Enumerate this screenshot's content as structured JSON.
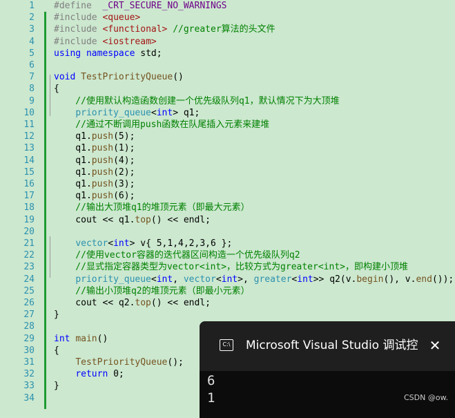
{
  "code_lines": [
    {
      "n": "1",
      "tokens": [
        {
          "t": "#define  ",
          "c": "p"
        },
        {
          "t": "_CRT_SECURE_NO_WARNINGS",
          "c": "m"
        }
      ]
    },
    {
      "n": "2",
      "tokens": [
        {
          "t": "#include ",
          "c": "p"
        },
        {
          "t": "<queue>",
          "c": "s"
        }
      ]
    },
    {
      "n": "3",
      "tokens": [
        {
          "t": "#include ",
          "c": "p"
        },
        {
          "t": "<functional>",
          "c": "s"
        },
        {
          "t": " //greater算法的头文件",
          "c": "c"
        }
      ]
    },
    {
      "n": "4",
      "tokens": [
        {
          "t": "#include ",
          "c": "p"
        },
        {
          "t": "<iostream>",
          "c": "s"
        }
      ]
    },
    {
      "n": "5",
      "tokens": [
        {
          "t": "using",
          "c": "k"
        },
        {
          "t": " ",
          "c": "n"
        },
        {
          "t": "namespace",
          "c": "k"
        },
        {
          "t": " std;",
          "c": "n"
        }
      ]
    },
    {
      "n": "6",
      "tokens": []
    },
    {
      "n": "7",
      "tokens": [
        {
          "t": "void",
          "c": "k"
        },
        {
          "t": " ",
          "c": "n"
        },
        {
          "t": "TestPriorityQueue",
          "c": "f"
        },
        {
          "t": "()",
          "c": "n"
        }
      ]
    },
    {
      "n": "8",
      "tokens": [
        {
          "t": "{",
          "c": "n"
        }
      ]
    },
    {
      "n": "9",
      "tokens": [
        {
          "t": "    //使用默认构造函数创建一个优先级队列q1，默认情况下为大顶堆",
          "c": "c"
        }
      ]
    },
    {
      "n": "10",
      "tokens": [
        {
          "t": "    ",
          "c": "n"
        },
        {
          "t": "priority_queue",
          "c": "t"
        },
        {
          "t": "<",
          "c": "n"
        },
        {
          "t": "int",
          "c": "k"
        },
        {
          "t": "> q1;",
          "c": "n"
        }
      ]
    },
    {
      "n": "11",
      "tokens": [
        {
          "t": "    //通过不断调用push函数在队尾插入元素来建堆",
          "c": "c"
        }
      ]
    },
    {
      "n": "12",
      "tokens": [
        {
          "t": "    q1.",
          "c": "n"
        },
        {
          "t": "push",
          "c": "f"
        },
        {
          "t": "(5);",
          "c": "n"
        }
      ]
    },
    {
      "n": "13",
      "tokens": [
        {
          "t": "    q1.",
          "c": "n"
        },
        {
          "t": "push",
          "c": "f"
        },
        {
          "t": "(1);",
          "c": "n"
        }
      ]
    },
    {
      "n": "14",
      "tokens": [
        {
          "t": "    q1.",
          "c": "n"
        },
        {
          "t": "push",
          "c": "f"
        },
        {
          "t": "(4);",
          "c": "n"
        }
      ]
    },
    {
      "n": "15",
      "tokens": [
        {
          "t": "    q1.",
          "c": "n"
        },
        {
          "t": "push",
          "c": "f"
        },
        {
          "t": "(2);",
          "c": "n"
        }
      ]
    },
    {
      "n": "16",
      "tokens": [
        {
          "t": "    q1.",
          "c": "n"
        },
        {
          "t": "push",
          "c": "f"
        },
        {
          "t": "(3);",
          "c": "n"
        }
      ]
    },
    {
      "n": "17",
      "tokens": [
        {
          "t": "    q1.",
          "c": "n"
        },
        {
          "t": "push",
          "c": "f"
        },
        {
          "t": "(6);",
          "c": "n"
        }
      ]
    },
    {
      "n": "18",
      "tokens": [
        {
          "t": "    //输出大顶堆q1的堆顶元素（即最大元素）",
          "c": "c"
        }
      ]
    },
    {
      "n": "19",
      "tokens": [
        {
          "t": "    cout << q1.",
          "c": "n"
        },
        {
          "t": "top",
          "c": "f"
        },
        {
          "t": "() << endl;",
          "c": "n"
        }
      ]
    },
    {
      "n": "20",
      "tokens": []
    },
    {
      "n": "21",
      "tokens": [
        {
          "t": "    ",
          "c": "n"
        },
        {
          "t": "vector",
          "c": "t"
        },
        {
          "t": "<",
          "c": "n"
        },
        {
          "t": "int",
          "c": "k"
        },
        {
          "t": "> v{ 5,1,4,2,3,6 };",
          "c": "n"
        }
      ]
    },
    {
      "n": "22",
      "tokens": [
        {
          "t": "    //使用vector容器的迭代器区间构造一个优先级队列q2",
          "c": "c"
        }
      ]
    },
    {
      "n": "23",
      "tokens": [
        {
          "t": "    //显式指定容器类型为vector<int>，比较方式为greater<int>，即构建小顶堆",
          "c": "c"
        }
      ]
    },
    {
      "n": "24",
      "tokens": [
        {
          "t": "    ",
          "c": "n"
        },
        {
          "t": "priority_queue",
          "c": "t"
        },
        {
          "t": "<",
          "c": "n"
        },
        {
          "t": "int",
          "c": "k"
        },
        {
          "t": ", ",
          "c": "n"
        },
        {
          "t": "vector",
          "c": "t"
        },
        {
          "t": "<",
          "c": "n"
        },
        {
          "t": "int",
          "c": "k"
        },
        {
          "t": ">, ",
          "c": "n"
        },
        {
          "t": "greater",
          "c": "t"
        },
        {
          "t": "<",
          "c": "n"
        },
        {
          "t": "int",
          "c": "k"
        },
        {
          "t": ">> q2(v.",
          "c": "n"
        },
        {
          "t": "begin",
          "c": "f"
        },
        {
          "t": "(), v.",
          "c": "n"
        },
        {
          "t": "end",
          "c": "f"
        },
        {
          "t": "());",
          "c": "n"
        }
      ]
    },
    {
      "n": "25",
      "tokens": [
        {
          "t": "    //输出小顶堆q2的堆顶元素（即最小元素）",
          "c": "c"
        }
      ]
    },
    {
      "n": "26",
      "tokens": [
        {
          "t": "    cout << q2.",
          "c": "n"
        },
        {
          "t": "top",
          "c": "f"
        },
        {
          "t": "() << endl;",
          "c": "n"
        }
      ]
    },
    {
      "n": "27",
      "tokens": [
        {
          "t": "}",
          "c": "n"
        }
      ]
    },
    {
      "n": "28",
      "tokens": []
    },
    {
      "n": "29",
      "tokens": [
        {
          "t": "int",
          "c": "k"
        },
        {
          "t": " ",
          "c": "n"
        },
        {
          "t": "main",
          "c": "f"
        },
        {
          "t": "()",
          "c": "n"
        }
      ]
    },
    {
      "n": "30",
      "tokens": [
        {
          "t": "{",
          "c": "n"
        }
      ]
    },
    {
      "n": "31",
      "tokens": [
        {
          "t": "    ",
          "c": "n"
        },
        {
          "t": "TestPriorityQueue",
          "c": "f"
        },
        {
          "t": "();",
          "c": "n"
        }
      ]
    },
    {
      "n": "32",
      "tokens": [
        {
          "t": "    ",
          "c": "n"
        },
        {
          "t": "return",
          "c": "k"
        },
        {
          "t": " 0;",
          "c": "n"
        }
      ]
    },
    {
      "n": "33",
      "tokens": [
        {
          "t": "}",
          "c": "n"
        }
      ]
    },
    {
      "n": "34",
      "tokens": []
    }
  ],
  "console": {
    "icon_label": "C:\\",
    "title": "Microsoft Visual Studio 调试控制台",
    "close_glyph": "✕",
    "output_lines": [
      "6",
      "1"
    ]
  },
  "watermark": "CSDN @ow.",
  "colors": {
    "editor_background": "#cce8cf",
    "line_number": "#2b91af",
    "keyword": "#0000ff",
    "comment": "#008000",
    "string": "#a31515",
    "type": "#2b91af",
    "change_bar": "#1e9b32",
    "console_background": "#0c0c0c",
    "console_titlebar": "#1f1f1f"
  }
}
